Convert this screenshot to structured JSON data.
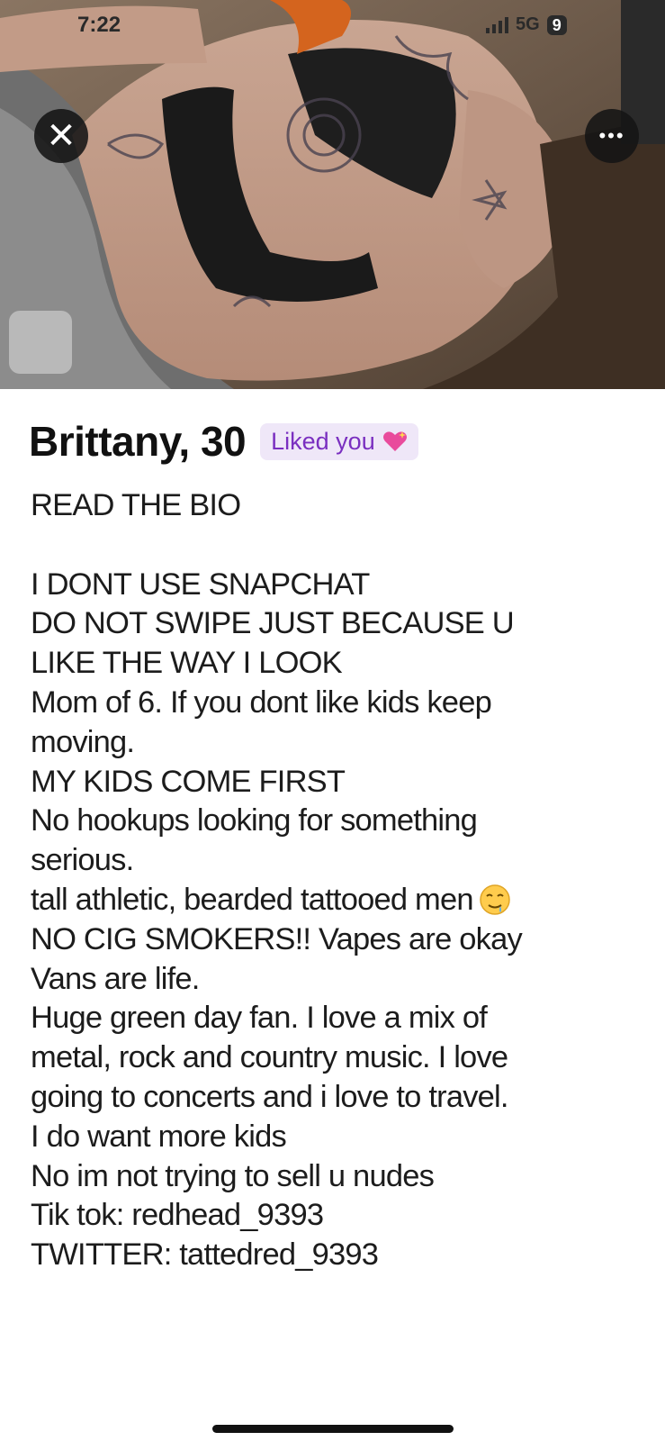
{
  "status_bar": {
    "time": "7:22",
    "network": "5G",
    "battery": "9"
  },
  "profile": {
    "name_age": "Brittany, 30",
    "liked_badge": "Liked you",
    "bio_lines": [
      "READ THE BIO",
      "",
      "I DONT USE SNAPCHAT",
      "DO NOT SWIPE JUST BECAUSE U",
      "LIKE THE WAY I LOOK",
      "Mom of 6. If you dont like kids keep",
      "moving.",
      "MY KIDS COME FIRST",
      "No hookups looking for something",
      "serious.",
      "tall athletic, bearded tattooed men",
      "NO CIG SMOKERS!! Vapes are okay",
      "Vans are life.",
      "Huge green day fan. I love a mix of",
      "metal, rock and country music. I love",
      "going to concerts and i love to travel.",
      "I do want more kids",
      "No im not trying to sell u nudes",
      "Tik tok: redhead_9393",
      "TWITTER: tattedred_9393"
    ]
  },
  "icons": {
    "close": "close-icon",
    "more": "more-icon",
    "heart": "sparkling-heart-icon",
    "emoji": "drooling-face-icon"
  },
  "colors": {
    "badge_bg": "#efe7f8",
    "badge_text": "#7a2fc0",
    "overlay_button": "#141414"
  }
}
